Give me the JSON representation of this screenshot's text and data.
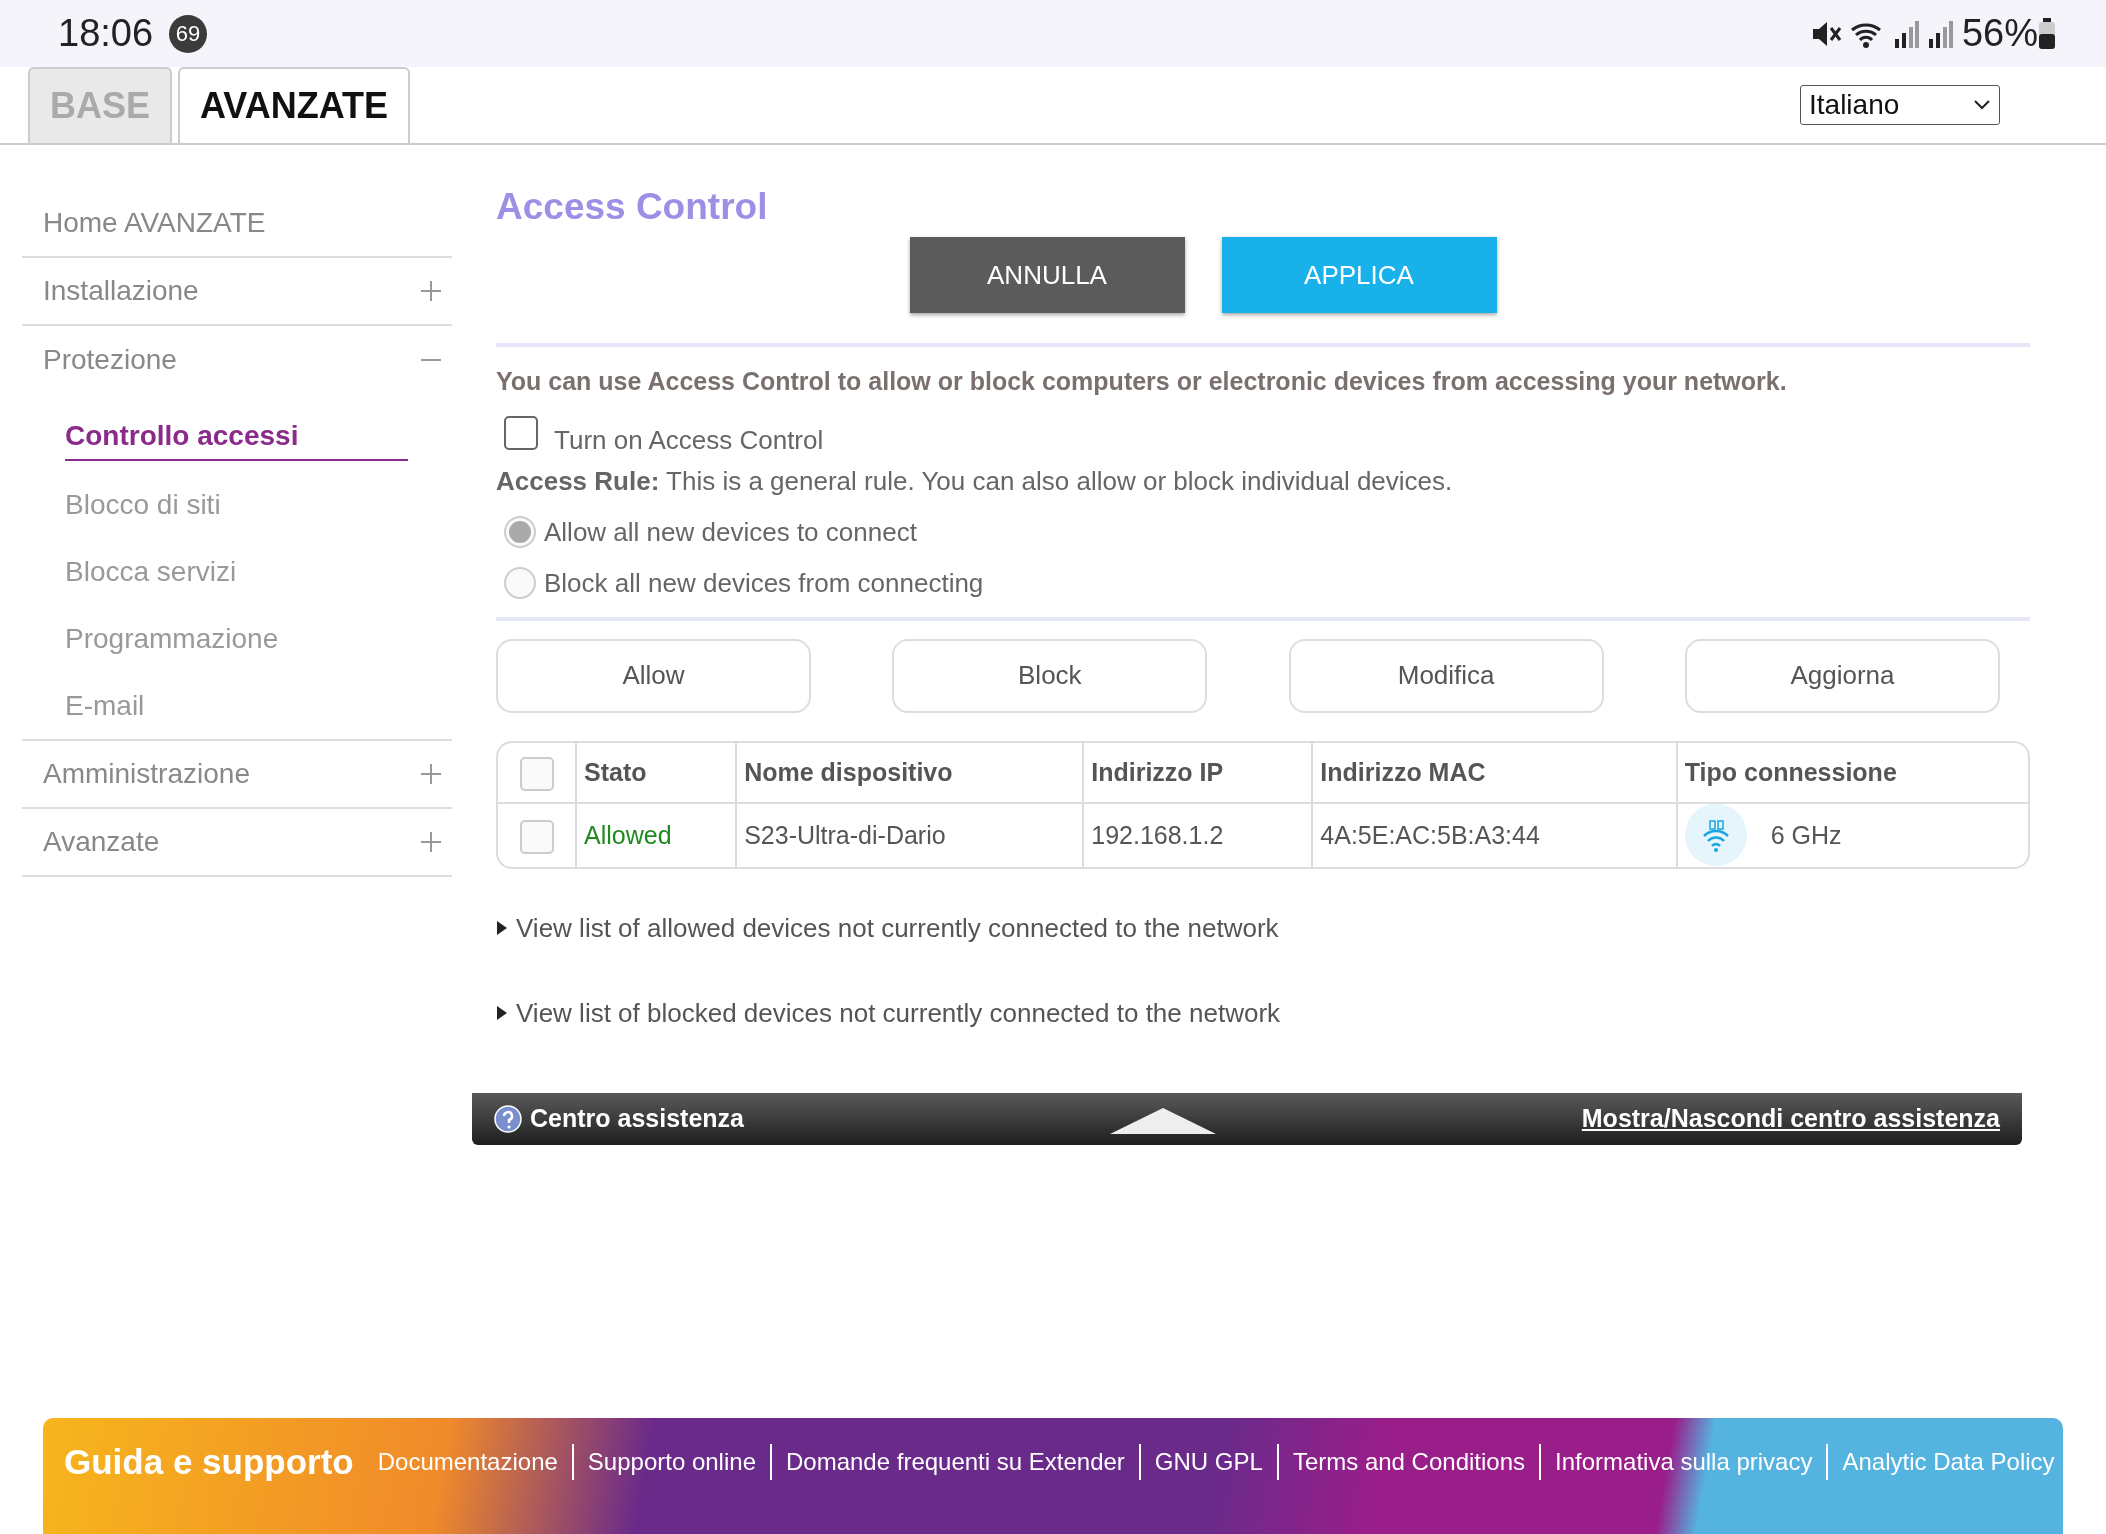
{
  "status_bar": {
    "time": "18:06",
    "notification_count": "69",
    "battery": "56%"
  },
  "tabs": [
    {
      "label": "BASE",
      "selected": false
    },
    {
      "label": "AVANZATE",
      "selected": true
    }
  ],
  "language_select": {
    "value": "Italiano"
  },
  "sidebar": {
    "items": [
      {
        "label": "Home AVANZATE",
        "kind": "link"
      },
      {
        "label": "Installazione",
        "kind": "group",
        "expanded": false
      },
      {
        "label": "Protezione",
        "kind": "group",
        "expanded": true,
        "children": [
          {
            "label": "Controllo accessi",
            "selected": true
          },
          {
            "label": "Blocco di siti",
            "selected": false
          },
          {
            "label": "Blocca servizi",
            "selected": false
          },
          {
            "label": "Programmazione",
            "selected": false
          },
          {
            "label": "E-mail",
            "selected": false
          }
        ]
      },
      {
        "label": "Amministrazione",
        "kind": "group",
        "expanded": false
      },
      {
        "label": "Avanzate",
        "kind": "group",
        "expanded": false
      }
    ]
  },
  "page_title": "Access Control",
  "top_buttons": [
    {
      "label": "ANNULLA",
      "kind": "cancel"
    },
    {
      "label": "APPLICA",
      "kind": "apply"
    }
  ],
  "description": "You can use Access Control to allow or block computers or electronic devices from accessing your network.",
  "enable_checkbox": {
    "label": "Turn on Access Control",
    "checked": false
  },
  "access_rule": "**Access Rule:** This is a general rule. You can also allow or block individual devices.",
  "rule_options": [
    {
      "label": "Allow all new devices to connect",
      "selected": true,
      "disabled": true
    },
    {
      "label": "Block all new devices from connecting",
      "selected": false,
      "disabled": true
    }
  ],
  "action_buttons": [
    "Allow",
    "Block",
    "Modifica",
    "Aggiorna"
  ],
  "table": {
    "select_all_checked": false,
    "columns": [
      "Stato",
      "Nome dispositivo",
      "Indirizzo IP",
      "Indirizzo MAC",
      "Tipo connessione"
    ],
    "rows": [
      {
        "checked": false,
        "cells": [
          "Allowed",
          "S23-Ultra-di-Dario",
          "192.168.1.2",
          "4A:5E:AC:5B:A3:44",
          "6 GHz"
        ]
      }
    ]
  },
  "expanders": [
    {
      "label": "View list of allowed devices not currently connected to the network",
      "expanded": false
    },
    {
      "label": "View list of blocked devices not currently connected to the network",
      "expanded": false
    }
  ],
  "help_bar": {
    "title": "Centro assistenza",
    "toggle_link": "Mostra/Nascondi centro assistenza"
  },
  "footer": {
    "title": "Guida e supporto",
    "links": [
      "Documentazione",
      "Supporto online",
      "Domande frequenti su Extender",
      "GNU GPL",
      "Terms and Conditions",
      "Informativa sulla privacy",
      "Analytic Data Policy"
    ]
  }
}
